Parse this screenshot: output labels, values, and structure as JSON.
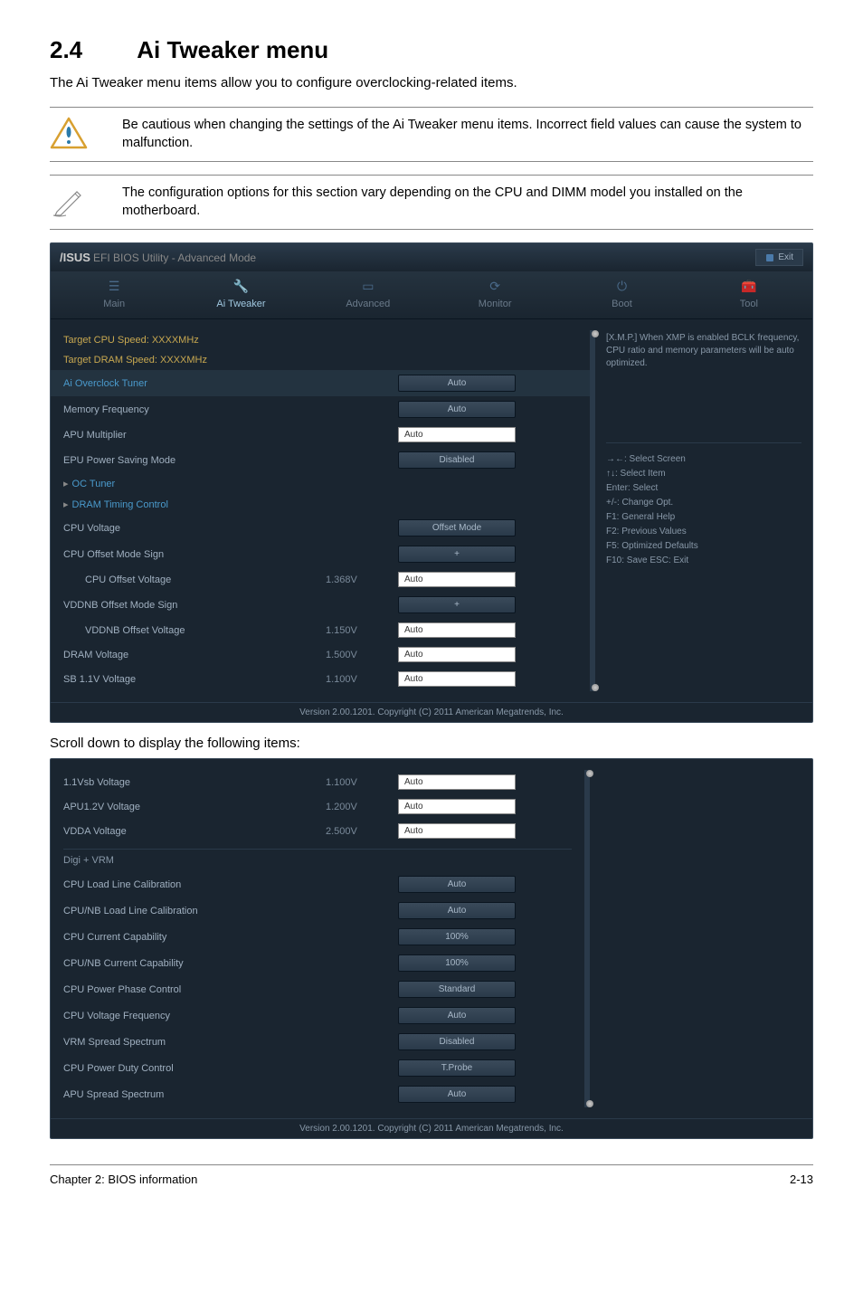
{
  "section": {
    "number": "2.4",
    "title": "Ai Tweaker menu"
  },
  "intro": "The Ai Tweaker menu items allow you to configure overclocking-related items.",
  "warning": "Be cautious when changing the settings of the Ai Tweaker menu items. Incorrect field values can cause the system to malfunction.",
  "note": "The configuration options for this section vary depending on the CPU and DIMM model you installed on the motherboard.",
  "bios": {
    "logo_brand": "/ISUS",
    "logo_sub": "EFI BIOS Utility - Advanced Mode",
    "exit": "Exit",
    "tabs": [
      "Main",
      "Ai Tweaker",
      "Advanced",
      "Monitor",
      "Boot",
      "Tool"
    ],
    "active_tab": 1,
    "help": "[X.M.P.] When XMP is enabled BCLK frequency, CPU ratio and memory parameters will be auto optimized.",
    "keys": [
      "→←: Select Screen",
      "↑↓: Select Item",
      "Enter: Select",
      "+/-: Change Opt.",
      "F1: General Help",
      "F2: Previous Values",
      "F5: Optimized Defaults",
      "F10: Save   ESC: Exit"
    ],
    "rows1": [
      {
        "label": "Target CPU Speed: XXXXMHz",
        "type": "info",
        "cls": "highlight-yellow"
      },
      {
        "label": "Target DRAM Speed: XXXXMHz",
        "type": "info",
        "cls": "highlight-yellow"
      },
      {
        "label": "Ai Overclock Tuner",
        "type": "dd",
        "val": "Auto",
        "cls": "highlight-cyan highlight-row"
      },
      {
        "label": "Memory Frequency",
        "type": "dd",
        "val": "Auto"
      },
      {
        "label": "APU Multiplier",
        "type": "input",
        "val": "Auto"
      },
      {
        "label": "EPU Power Saving Mode",
        "type": "dd",
        "val": "Disabled"
      },
      {
        "label": "OC Tuner",
        "type": "sub",
        "cls": "highlight-cyan"
      },
      {
        "label": "DRAM Timing Control",
        "type": "sub",
        "cls": "highlight-cyan"
      },
      {
        "label": "CPU Voltage",
        "type": "dd",
        "val": "Offset Mode"
      },
      {
        "label": "CPU Offset Mode Sign",
        "type": "dd",
        "val": "+"
      },
      {
        "label": "CPU Offset Voltage",
        "type": "input",
        "val": "Auto",
        "readout": "1.368V",
        "indent": true
      },
      {
        "label": "VDDNB Offset Mode Sign",
        "type": "dd",
        "val": "+"
      },
      {
        "label": "VDDNB Offset Voltage",
        "type": "input",
        "val": "Auto",
        "readout": "1.150V",
        "indent": true
      },
      {
        "label": "DRAM Voltage",
        "type": "input",
        "val": "Auto",
        "readout": "1.500V"
      },
      {
        "label": "SB 1.1V Voltage",
        "type": "input",
        "val": "Auto",
        "readout": "1.100V"
      }
    ],
    "footer": "Version 2.00.1201. Copyright (C) 2011 American Megatrends, Inc."
  },
  "scroll_caption": "Scroll down to display the following items:",
  "bios2": {
    "rows2a": [
      {
        "label": "1.1Vsb Voltage",
        "type": "input",
        "val": "Auto",
        "readout": "1.100V"
      },
      {
        "label": "APU1.2V Voltage",
        "type": "input",
        "val": "Auto",
        "readout": "1.200V"
      },
      {
        "label": "VDDA Voltage",
        "type": "input",
        "val": "Auto",
        "readout": "2.500V"
      }
    ],
    "section_head": "Digi + VRM",
    "rows2b": [
      {
        "label": "CPU Load Line Calibration",
        "type": "dd",
        "val": "Auto"
      },
      {
        "label": "CPU/NB Load Line Calibration",
        "type": "dd",
        "val": "Auto"
      },
      {
        "label": "CPU Current Capability",
        "type": "dd",
        "val": "100%"
      },
      {
        "label": "CPU/NB Current Capability",
        "type": "dd",
        "val": "100%"
      },
      {
        "label": "CPU Power Phase Control",
        "type": "dd",
        "val": "Standard"
      },
      {
        "label": "CPU Voltage Frequency",
        "type": "dd",
        "val": "Auto"
      },
      {
        "label": "VRM Spread Spectrum",
        "type": "dd",
        "val": "Disabled"
      },
      {
        "label": "CPU Power Duty Control",
        "type": "dd",
        "val": "T.Probe"
      },
      {
        "label": "APU Spread Spectrum",
        "type": "dd",
        "val": "Auto"
      }
    ],
    "footer": "Version 2.00.1201. Copyright (C) 2011 American Megatrends, Inc."
  },
  "page_footer": {
    "left": "Chapter 2: BIOS information",
    "right": "2-13"
  }
}
